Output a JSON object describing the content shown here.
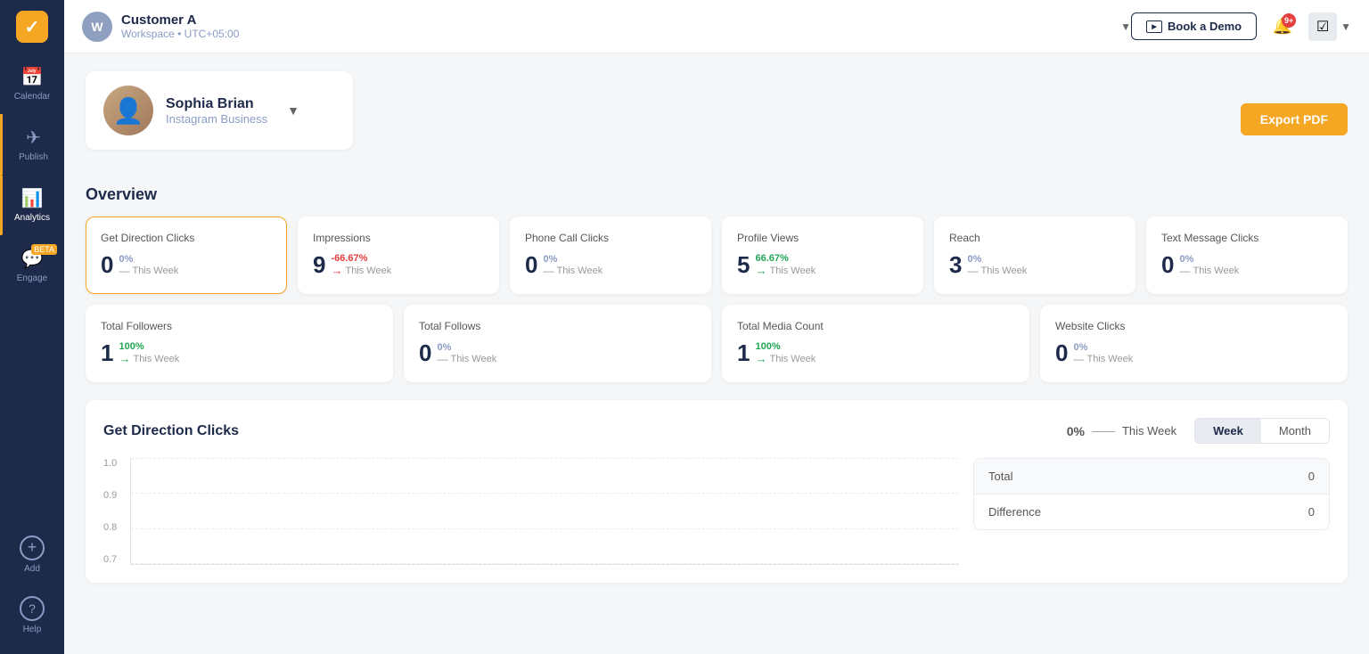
{
  "sidebar": {
    "logo": "✓",
    "items": [
      {
        "id": "calendar",
        "label": "Calendar",
        "icon": "📅",
        "active": false
      },
      {
        "id": "publish",
        "label": "Publish",
        "icon": "✈",
        "active": false
      },
      {
        "id": "analytics",
        "label": "Analytics",
        "icon": "📊",
        "active": true
      },
      {
        "id": "engage",
        "label": "Engage",
        "icon": "💬",
        "active": false
      }
    ],
    "bottom_items": [
      {
        "id": "add",
        "label": "Add",
        "icon": "⊕"
      },
      {
        "id": "help",
        "label": "Help",
        "icon": "?"
      }
    ]
  },
  "topbar": {
    "workspace_initial": "W",
    "workspace_name": "Customer A",
    "workspace_sub": "Workspace • UTC+05:00",
    "book_demo_label": "Book a Demo",
    "notification_count": "9+",
    "demo_icon_label": "DEMO"
  },
  "profile": {
    "name": "Sophia Brian",
    "platform": "Instagram Business",
    "export_label": "Export PDF"
  },
  "overview": {
    "title": "Overview",
    "stats_row1": [
      {
        "id": "get-direction-clicks",
        "title": "Get Direction Clicks",
        "value": "0",
        "pct": "0%",
        "pct_class": "neutral",
        "period": "This Week",
        "arrow": "dash",
        "active": true
      },
      {
        "id": "impressions",
        "title": "Impressions",
        "value": "9",
        "pct": "-66.67%",
        "pct_class": "red",
        "period": "This Week",
        "arrow": "right-red",
        "active": false
      },
      {
        "id": "phone-call-clicks",
        "title": "Phone Call Clicks",
        "value": "0",
        "pct": "0%",
        "pct_class": "neutral",
        "period": "This Week",
        "arrow": "dash",
        "active": false
      },
      {
        "id": "profile-views",
        "title": "Profile Views",
        "value": "5",
        "pct": "66.67%",
        "pct_class": "green",
        "period": "This Week",
        "arrow": "right-green",
        "active": false
      },
      {
        "id": "reach",
        "title": "Reach",
        "value": "3",
        "pct": "0%",
        "pct_class": "neutral",
        "period": "This Week",
        "arrow": "dash",
        "active": false
      },
      {
        "id": "text-message-clicks",
        "title": "Text Message Clicks",
        "value": "0",
        "pct": "0%",
        "pct_class": "neutral",
        "period": "This Week",
        "arrow": "dash",
        "active": false
      }
    ],
    "stats_row2": [
      {
        "id": "total-followers",
        "title": "Total Followers",
        "value": "1",
        "pct": "100%",
        "pct_class": "green",
        "period": "This Week",
        "arrow": "right-green",
        "active": false
      },
      {
        "id": "total-follows",
        "title": "Total Follows",
        "value": "0",
        "pct": "0%",
        "pct_class": "neutral",
        "period": "This Week",
        "arrow": "dash",
        "active": false
      },
      {
        "id": "total-media-count",
        "title": "Total Media Count",
        "value": "1",
        "pct": "100%",
        "pct_class": "green",
        "period": "This Week",
        "arrow": "right-green",
        "active": false
      },
      {
        "id": "website-clicks",
        "title": "Website Clicks",
        "value": "0",
        "pct": "0%",
        "pct_class": "neutral",
        "period": "This Week",
        "arrow": "dash",
        "active": false
      }
    ]
  },
  "chart": {
    "title": "Get Direction Clicks",
    "pct": "0%",
    "period": "This Week",
    "toggle": {
      "week_label": "Week",
      "month_label": "Month",
      "active": "week"
    },
    "y_labels": [
      "1.0",
      "0.9",
      "0.8",
      "0.7"
    ],
    "table": [
      {
        "label": "Total",
        "value": "0"
      },
      {
        "label": "Difference",
        "value": "0"
      }
    ]
  }
}
